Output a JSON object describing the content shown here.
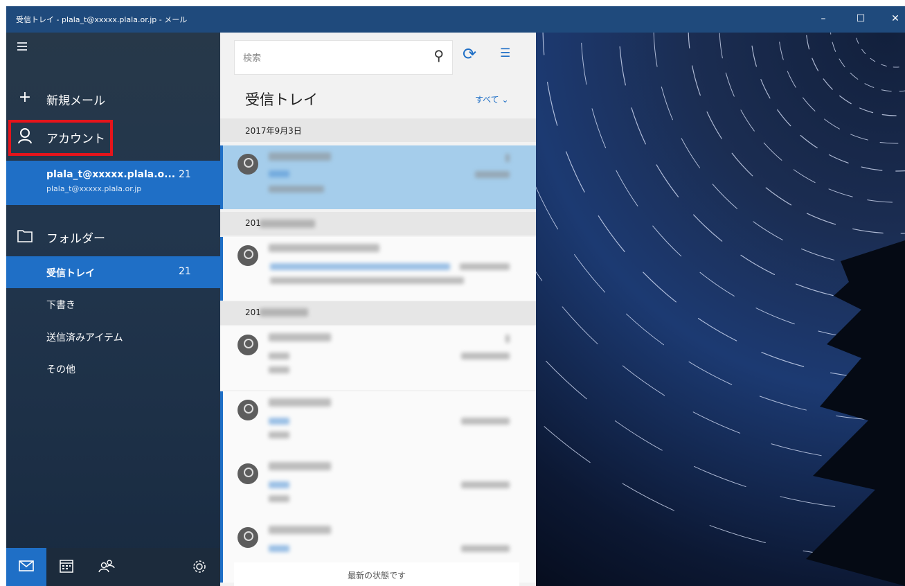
{
  "window": {
    "title": "受信トレイ - plala_t@xxxxx.plala.or.jp - メール",
    "minimize_label": "–",
    "maximize_label": "☐",
    "close_label": "✕"
  },
  "sidebar": {
    "new_mail_label": "新規メール",
    "accounts_label": "アカウント",
    "account": {
      "name": "plala_t@xxxxx.plala.o...",
      "email": "plala_t@xxxxx.plala.or.jp",
      "unread_count": "21"
    },
    "folders_label": "フォルダー",
    "folders": [
      {
        "label": "受信トレイ",
        "count": "21"
      },
      {
        "label": "下書き",
        "count": ""
      },
      {
        "label": "送信済みアイテム",
        "count": ""
      },
      {
        "label": "その他",
        "count": ""
      }
    ]
  },
  "message_list": {
    "search_placeholder": "検索",
    "title": "受信トレイ",
    "filter_label": "すべて",
    "date_headers": [
      "2017年9月3日",
      "201",
      "201"
    ],
    "status_text": "最新の状態です"
  },
  "colors": {
    "accent": "#1f6fc6",
    "highlight_border": "#e5141b",
    "selected_message": "#a5cdeb"
  }
}
